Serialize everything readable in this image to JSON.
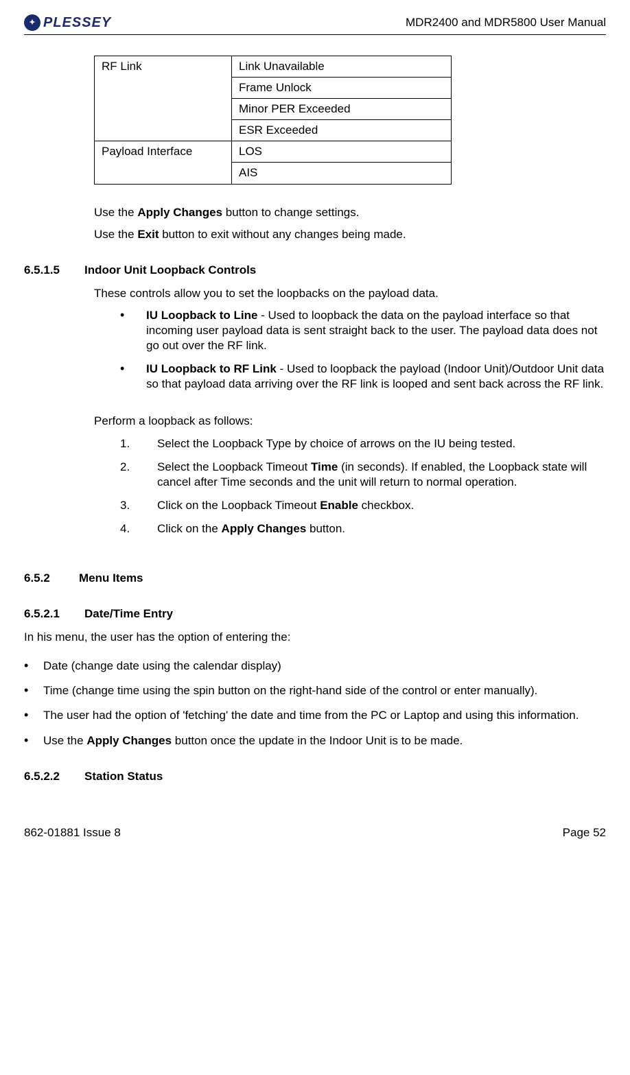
{
  "header": {
    "logo_text": "PLESSEY",
    "doc_title": "MDR2400 and MDR5800 User Manual"
  },
  "table": {
    "rows": [
      {
        "group": "RF Link",
        "item": "Link Unavailable",
        "rowspan": 4
      },
      {
        "group": "",
        "item": "Frame Unlock"
      },
      {
        "group": "",
        "item": "Minor PER Exceeded"
      },
      {
        "group": "",
        "item": "ESR Exceeded"
      },
      {
        "group": "Payload Interface",
        "item": "LOS",
        "rowspan": 2
      },
      {
        "group": "",
        "item": "AIS"
      }
    ],
    "rf_link": "RF Link",
    "payload_interface": "Payload Interface",
    "link_unavailable": "Link Unavailable",
    "frame_unlock": "Frame Unlock",
    "minor_per": "Minor PER Exceeded",
    "esr_exceeded": "ESR Exceeded",
    "los": "LOS",
    "ais": "AIS"
  },
  "body": {
    "apply_line_pre": "Use the ",
    "apply_bold": "Apply Changes",
    "apply_line_post": " button to change settings.",
    "exit_line_pre": "Use the ",
    "exit_bold": "Exit",
    "exit_line_post": " button to exit without any changes being made."
  },
  "s6515": {
    "num": "6.5.1.5",
    "title": "Indoor Unit Loopback Controls",
    "intro": "These controls allow you to set the loopbacks on the payload data.",
    "b1_bold": "IU Loopback to Line",
    "b1_text": " - Used to loopback the data on the payload interface so that incoming user payload data is sent straight back to the user.  The payload data does not go out over the RF link.",
    "b2_bold": "IU Loopback to RF Link",
    "b2_text": " - Used to loopback the payload (Indoor Unit)/Outdoor Unit data so that payload data arriving over the RF link is looped and sent back across the RF link.",
    "perform": "Perform a loopback as follows:",
    "step1": "Select the Loopback Type by choice of arrows on the IU being tested.",
    "step2_pre": "Select the Loopback Timeout ",
    "step2_bold": "Time",
    "step2_post": " (in seconds).  If enabled, the Loopback state will cancel after Time seconds and the unit will return to normal operation.",
    "step3_pre": "Click on the Loopback Timeout ",
    "step3_bold": "Enable",
    "step3_post": " checkbox.",
    "step4_pre": "Click on the ",
    "step4_bold": "Apply Changes",
    "step4_post": " button."
  },
  "s652": {
    "num": "6.5.2",
    "title": "Menu Items"
  },
  "s6521": {
    "num": "6.5.2.1",
    "title": "Date/Time Entry",
    "intro": "In his menu, the user has the option of entering the:",
    "b1": "Date (change date using the calendar display)",
    "b2": "Time (change time using the spin button on the right-hand side of the control or enter manually).",
    "b3": "The user had the option of 'fetching' the date and time from the PC or Laptop and using this information.",
    "b4_pre": "Use the ",
    "b4_bold": "Apply Changes",
    "b4_post": " button once the update in the Indoor Unit is to be made."
  },
  "s6522": {
    "num": "6.5.2.2",
    "title": "Station Status"
  },
  "footer": {
    "left": "862-01881 Issue 8",
    "right": "Page 52"
  }
}
